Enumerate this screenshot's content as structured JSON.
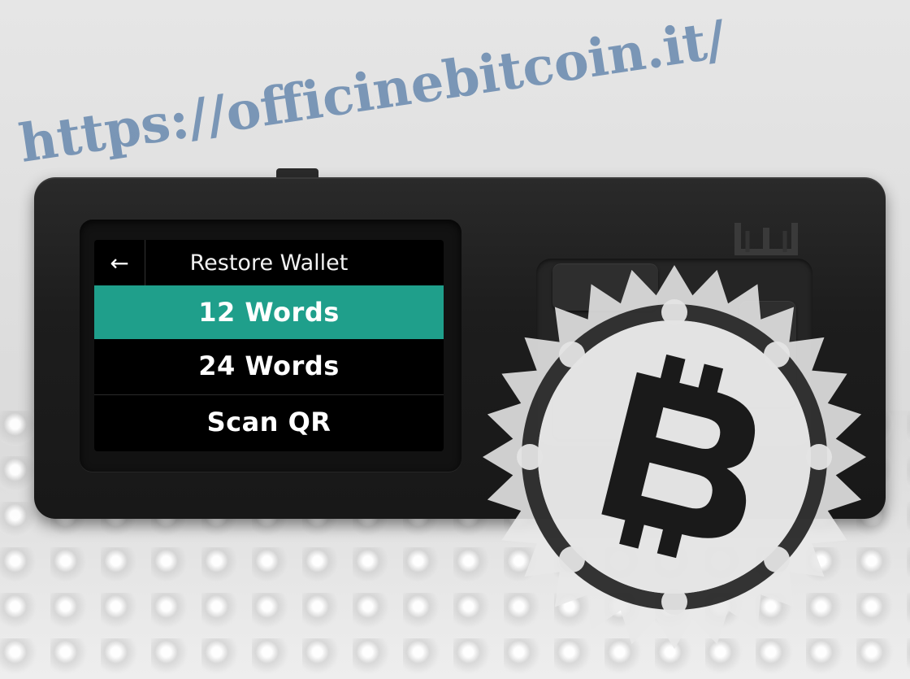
{
  "device_screen": {
    "back_glyph": "←",
    "title": "Restore Wallet",
    "menu": [
      {
        "label": "12 Words",
        "selected": true
      },
      {
        "label": "24 Words",
        "selected": false
      },
      {
        "label": "Scan QR",
        "selected": false
      }
    ],
    "selected_color": "#1f9f8b"
  },
  "watermark": {
    "url_text": "https://officinebitcoin.it/",
    "seal_icon": "bitcoin-seal-icon"
  }
}
